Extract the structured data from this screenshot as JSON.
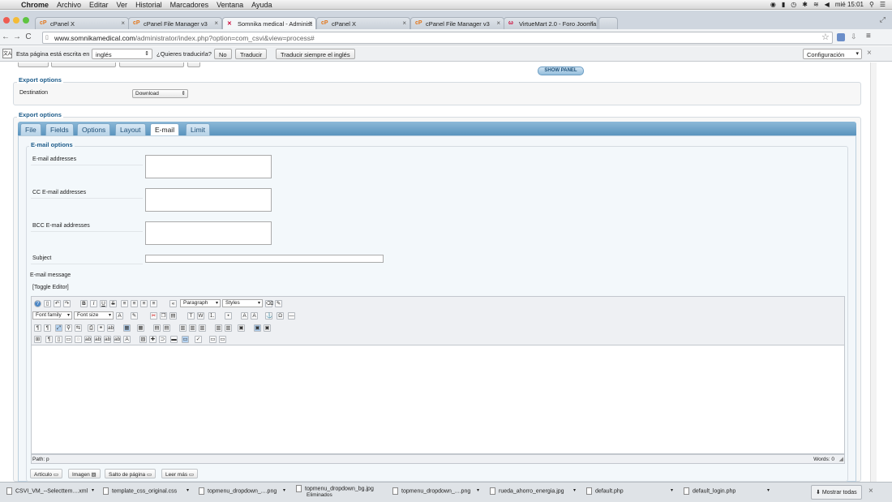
{
  "menubar": {
    "app": "Chrome",
    "items": [
      "Archivo",
      "Editar",
      "Ver",
      "Historial",
      "Marcadores",
      "Ventana",
      "Ayuda"
    ],
    "clock": "mié 15:01"
  },
  "tabs": [
    {
      "title": "cPanel X"
    },
    {
      "title": "cPanel File Manager v3"
    },
    {
      "title": "Somnika medical - Administ"
    },
    {
      "title": "cPanel X"
    },
    {
      "title": "cPanel File Manager v3"
    },
    {
      "title": "VirtueMart 2.0 - Foro Joomla"
    }
  ],
  "address": {
    "host": "www.somnikamedical.com",
    "path": "/administrator/index.php?option=com_csvi&view=process#"
  },
  "translate": {
    "text": "Esta página está escrita en",
    "language": "inglés",
    "question": "¿Quieres traducirla?",
    "no": "No",
    "translate": "Traducir",
    "always": "Traducir siempre el inglés",
    "settings": "Configuración"
  },
  "page": {
    "show_panel": "SHOW PANEL",
    "export_options_1": "Export options",
    "destination_label": "Destination",
    "destination_value": "Download",
    "export_options_2": "Export options",
    "tabs": [
      "File",
      "Fields",
      "Options",
      "Layout",
      "E-mail",
      "Limit"
    ],
    "active_tab": "E-mail",
    "email_options": "E-mail options",
    "email_addresses": "E-mail addresses",
    "cc_addresses": "CC E-mail addresses",
    "bcc_addresses": "BCC E-mail addresses",
    "subject": "Subject",
    "email_message": "E-mail message",
    "toggle_editor": "[Toggle Editor]",
    "toolbar": {
      "format": "Paragraph",
      "styles": "Styles",
      "font_family": "Font family",
      "font_size": "Font size"
    },
    "path": "Path: p",
    "words": "Words: 0",
    "editor_buttons": [
      "Artículo",
      "Imagen",
      "Salto de página",
      "Leer más"
    ]
  },
  "downloads": {
    "items": [
      {
        "name": "CSVI_VM_--Selecttem....xml",
        "sub": ""
      },
      {
        "name": "template_css_original.css",
        "sub": ""
      },
      {
        "name": "topmenu_dropdown_....png",
        "sub": ""
      },
      {
        "name": "topmenu_dropdown_bg.jpg",
        "sub": "Eliminados"
      },
      {
        "name": "topmenu_dropdown_....png",
        "sub": ""
      },
      {
        "name": "rueda_ahorro_energia.jpg",
        "sub": ""
      },
      {
        "name": "default.php",
        "sub": ""
      },
      {
        "name": "default_login.php",
        "sub": ""
      }
    ],
    "show_all": "Mostrar todas"
  }
}
